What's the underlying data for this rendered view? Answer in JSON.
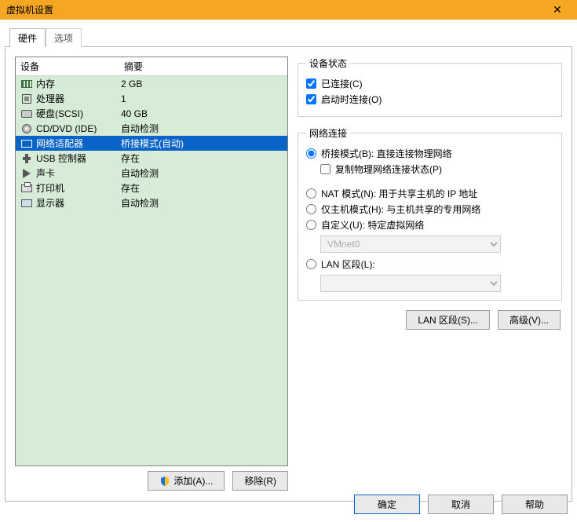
{
  "window": {
    "title": "虚拟机设置"
  },
  "tabs": {
    "hardware": "硬件",
    "options": "选项"
  },
  "columns": {
    "device": "设备",
    "summary": "摘要"
  },
  "devices": [
    {
      "name": "内存",
      "summary": "2 GB",
      "icon": "memory-icon"
    },
    {
      "name": "处理器",
      "summary": "1",
      "icon": "cpu-icon"
    },
    {
      "name": "硬盘(SCSI)",
      "summary": "40 GB",
      "icon": "hdd-icon"
    },
    {
      "name": "CD/DVD (IDE)",
      "summary": "自动检测",
      "icon": "cd-icon"
    },
    {
      "name": "网络适配器",
      "summary": "桥接模式(自动)",
      "icon": "network-icon",
      "selected": true
    },
    {
      "name": "USB 控制器",
      "summary": "存在",
      "icon": "usb-icon"
    },
    {
      "name": "声卡",
      "summary": "自动检测",
      "icon": "sound-icon"
    },
    {
      "name": "打印机",
      "summary": "存在",
      "icon": "printer-icon"
    },
    {
      "name": "显示器",
      "summary": "自动检测",
      "icon": "monitor-icon"
    }
  ],
  "devbuttons": {
    "add": "添加(A)...",
    "remove": "移除(R)"
  },
  "status": {
    "legend": "设备状态",
    "connected": {
      "label": "已连接(C)",
      "checked": true
    },
    "connect_at_power": {
      "label": "启动时连接(O)",
      "checked": true
    }
  },
  "netconn": {
    "legend": "网络连接",
    "bridged": {
      "label": "桥接模式(B): 直接连接物理网络",
      "selected": true
    },
    "replicate": {
      "label": "复制物理网络连接状态(P)",
      "checked": false
    },
    "nat": {
      "label": "NAT 模式(N): 用于共享主机的 IP 地址",
      "selected": false
    },
    "hostonly": {
      "label": "仅主机模式(H): 与主机共享的专用网络",
      "selected": false
    },
    "custom": {
      "label": "自定义(U): 特定虚拟网络",
      "selected": false
    },
    "custom_value": "VMnet0",
    "lanseg": {
      "label": "LAN 区段(L):",
      "selected": false
    },
    "lanseg_value": ""
  },
  "rbuttons": {
    "lanseg": "LAN 区段(S)...",
    "advanced": "高级(V)..."
  },
  "footer": {
    "ok": "确定",
    "cancel": "取消",
    "help": "帮助"
  }
}
